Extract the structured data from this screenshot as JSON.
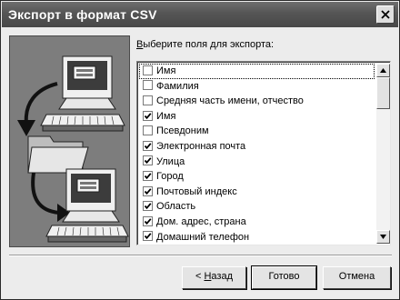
{
  "window": {
    "title": "Экспорт в формат CSV"
  },
  "instructions": {
    "label_first": "В",
    "label_rest": "ыберите поля для экспорта:"
  },
  "fields": [
    {
      "label": "Имя",
      "checked": false,
      "focused": true
    },
    {
      "label": "Фамилия",
      "checked": false
    },
    {
      "label": "Средняя часть имени, отчество",
      "checked": false
    },
    {
      "label": "Имя",
      "checked": true
    },
    {
      "label": "Псевдоним",
      "checked": false
    },
    {
      "label": "Электронная почта",
      "checked": true
    },
    {
      "label": "Улица",
      "checked": true
    },
    {
      "label": "Город",
      "checked": true
    },
    {
      "label": "Почтовый индекс",
      "checked": true
    },
    {
      "label": "Область",
      "checked": true
    },
    {
      "label": "Дом. адрес, страна",
      "checked": true
    },
    {
      "label": "Домашний телефон",
      "checked": true
    }
  ],
  "buttons": {
    "back_prefix": "< ",
    "back_hotkey": "Н",
    "back_rest": "азад",
    "finish": "Готово",
    "cancel": "Отмена"
  }
}
